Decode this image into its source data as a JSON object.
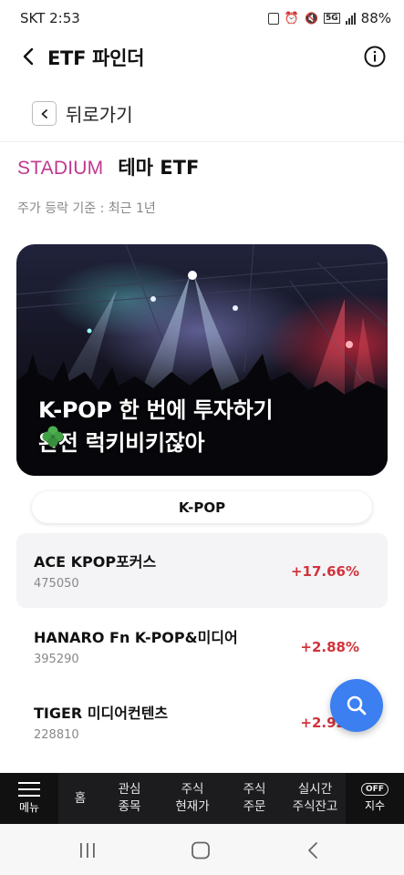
{
  "status_bar": {
    "time": "SKT 2:53",
    "battery": "88%",
    "network": "5G"
  },
  "header": {
    "title": "ETF 파인더"
  },
  "back_link": {
    "label": "뒤로가기"
  },
  "theme_header": {
    "brand": "STADIUM",
    "title": "테마 ETF"
  },
  "price_basis": "주가 등락 기준 : 최근 1년",
  "banner": {
    "line1": "K-POP 한 번에 투자하기",
    "line2": "완전 럭키비키잖아"
  },
  "category": {
    "label": "K-POP"
  },
  "etfs": [
    {
      "name": "ACE KPOP포커스",
      "code": "475050",
      "change": "+17.66%"
    },
    {
      "name": "HANARO Fn K-POP&미디어",
      "code": "395290",
      "change": "+2.88%"
    },
    {
      "name": "TIGER 미디어컨텐츠",
      "code": "228810",
      "change": "+2.92%"
    }
  ],
  "tabs": {
    "menu": "메뉴",
    "home": "홈",
    "watch_1": "관심",
    "watch_2": "종목",
    "price_1": "주식",
    "price_2": "현재가",
    "order_1": "주식",
    "order_2": "주문",
    "real_1": "실시간",
    "real_2": "주식잔고",
    "off_badge": "OFF",
    "index": "지수"
  },
  "colors": {
    "brand": "#c2388f",
    "positive": "#d2333c",
    "fab": "#3b7ff0"
  }
}
